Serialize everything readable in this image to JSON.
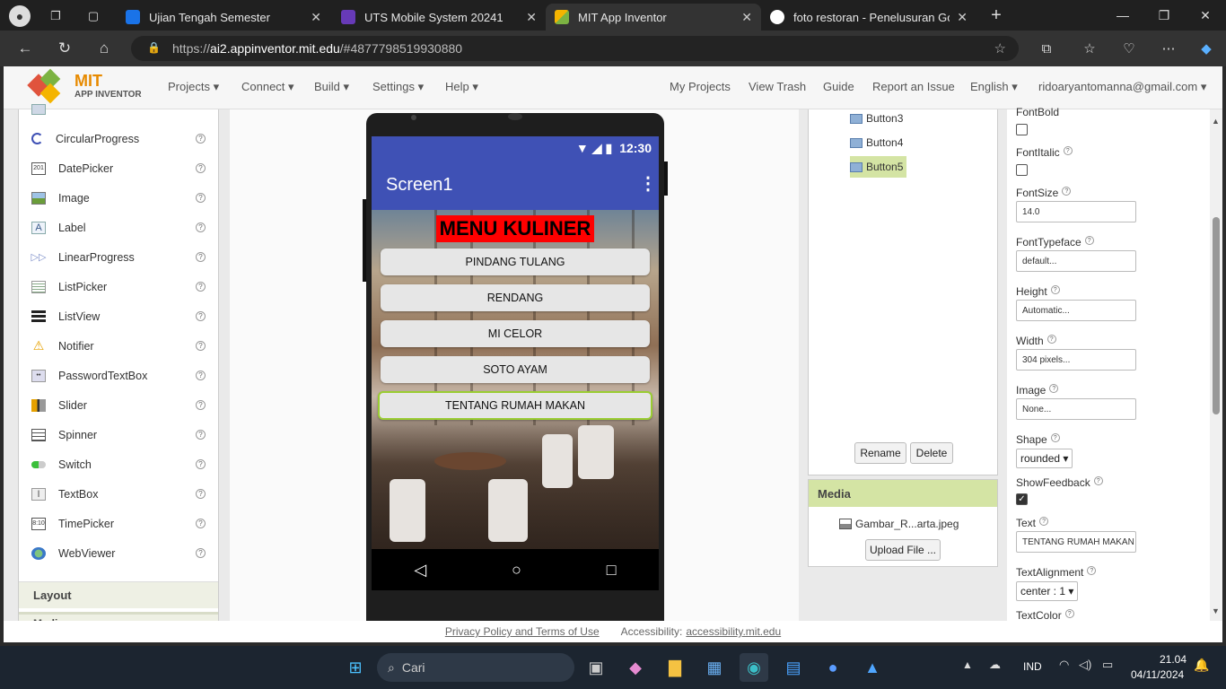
{
  "browser": {
    "tabs": [
      {
        "title": "Ujian Tengah Semester",
        "color": "#1a73e8"
      },
      {
        "title": "UTS Mobile System 20241",
        "color": "#673ab7"
      },
      {
        "title": "MIT App Inventor",
        "color": "#f4b400"
      },
      {
        "title": "foto restoran - Penelusuran Goog",
        "color": "#ffffff"
      }
    ],
    "url_scheme": "https://",
    "url_host": "ai2.appinventor.mit.edu",
    "url_rest": "/#4877798519930880"
  },
  "header": {
    "logo_top": "MIT",
    "logo_bottom": "APP INVENTOR",
    "menus": [
      "Projects ▾",
      "Connect ▾",
      "Build ▾",
      "Settings ▾",
      "Help ▾"
    ],
    "links": [
      "My Projects",
      "View Trash",
      "Guide",
      "Report an Issue",
      "English ▾",
      "ridoaryantomanna@gmail.com ▾"
    ]
  },
  "palette": {
    "items": [
      {
        "label": "CircularProgress",
        "icon": "circular-progress-icon"
      },
      {
        "label": "DatePicker",
        "icon": "date-picker-icon"
      },
      {
        "label": "Image",
        "icon": "image-icon"
      },
      {
        "label": "Label",
        "icon": "label-icon"
      },
      {
        "label": "LinearProgress",
        "icon": "linear-progress-icon"
      },
      {
        "label": "ListPicker",
        "icon": "list-picker-icon"
      },
      {
        "label": "ListView",
        "icon": "list-view-icon"
      },
      {
        "label": "Notifier",
        "icon": "notifier-icon"
      },
      {
        "label": "PasswordTextBox",
        "icon": "password-icon"
      },
      {
        "label": "Slider",
        "icon": "slider-icon"
      },
      {
        "label": "Spinner",
        "icon": "spinner-icon"
      },
      {
        "label": "Switch",
        "icon": "switch-icon"
      },
      {
        "label": "TextBox",
        "icon": "textbox-icon"
      },
      {
        "label": "TimePicker",
        "icon": "time-picker-icon"
      },
      {
        "label": "WebViewer",
        "icon": "webviewer-icon"
      }
    ],
    "section_layout": "Layout",
    "section_media_partial": "Media"
  },
  "phone": {
    "time": "12:30",
    "screen_title": "Screen1",
    "menu_title": "MENU KULINER",
    "buttons": [
      "PINDANG TULANG",
      "RENDANG",
      "MI CELOR",
      "SOTO AYAM",
      "TENTANG RUMAH MAKAN"
    ]
  },
  "components": {
    "items": [
      "Button3",
      "Button4",
      "Button5"
    ],
    "rename": "Rename",
    "delete": "Delete"
  },
  "media": {
    "title": "Media",
    "file": "Gambar_R...arta.jpeg",
    "upload": "Upload File ..."
  },
  "properties": {
    "fontbold": "FontBold",
    "fontitalic": "FontItalic",
    "fontsize": "FontSize",
    "fontsize_val": "14.0",
    "fonttypeface": "FontTypeface",
    "fonttypeface_val": "default...",
    "height": "Height",
    "height_val": "Automatic...",
    "width": "Width",
    "width_val": "304 pixels...",
    "image": "Image",
    "image_val": "None...",
    "shape": "Shape",
    "shape_val": "rounded ▾",
    "showfeedback": "ShowFeedback",
    "text": "Text",
    "text_val": "TENTANG RUMAH MAKAN",
    "textalignment": "TextAlignment",
    "textalignment_val": "center : 1 ▾",
    "textcolor": "TextColor"
  },
  "footer": {
    "privacy": "Privacy Policy and Terms of Use",
    "access_label": "Accessibility:",
    "access_link": "accessibility.mit.edu"
  },
  "taskbar": {
    "search": "Cari",
    "lang": "IND",
    "time": "21.04",
    "date": "04/11/2024"
  }
}
